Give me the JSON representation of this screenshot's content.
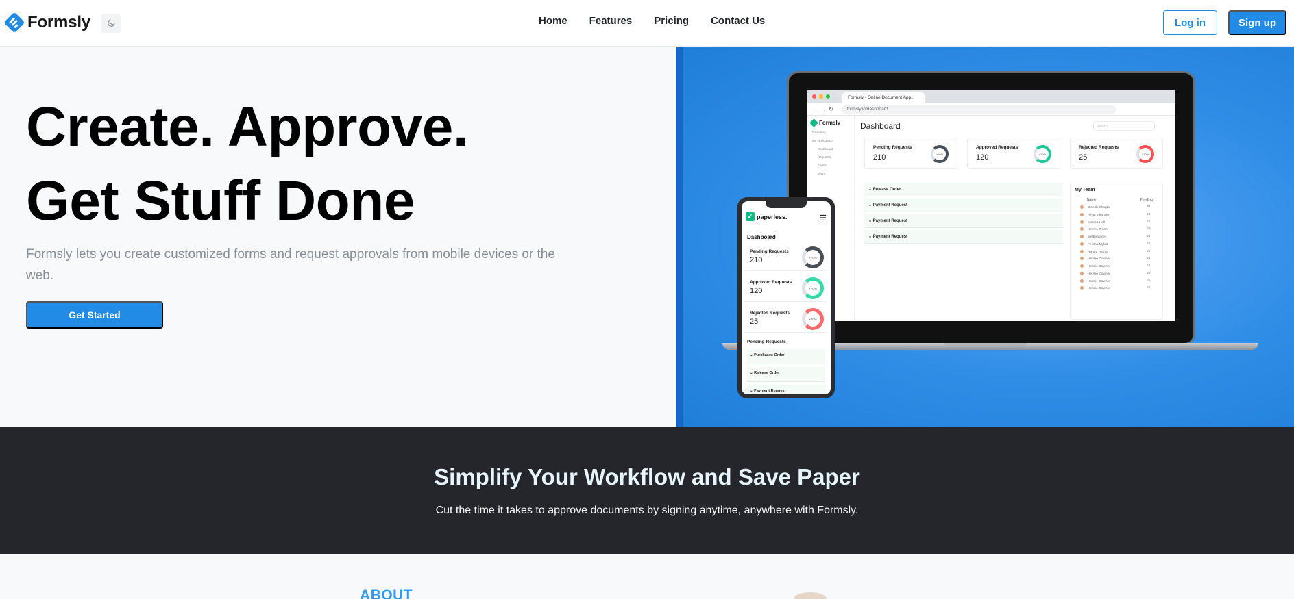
{
  "navbar": {
    "brand": "Formsly",
    "links": [
      "Home",
      "Features",
      "Pricing",
      "Contact Us"
    ],
    "login_label": "Log in",
    "signup_label": "Sign up",
    "theme_icon": "moon-icon"
  },
  "hero": {
    "title_line1": "Create. Approve.",
    "title_line2": "Get Stuff Done",
    "description": "Formsly lets you create customized forms and request approvals from mobile devices or the web.",
    "cta_label": "Get Started"
  },
  "laptop_mockup": {
    "tab_title": "Formsly - Online Document App...",
    "url": "formsly.io/dashboard",
    "sidebar_brand": "Formsly",
    "sidebar_items": [
      "Paperless",
      "My Workspace",
      "Dashboard",
      "Requests",
      "Forms",
      "Team"
    ],
    "page_title": "Dashboard",
    "search_placeholder": "Search",
    "stats": [
      {
        "label": "Pending Requests",
        "value": "210",
        "pct": "+10%",
        "color": "#495057"
      },
      {
        "label": "Approved Requests",
        "value": "120",
        "pct": "+10%",
        "color": "#20c997"
      },
      {
        "label": "Rejected Requests",
        "value": "25",
        "pct": "+10%",
        "color": "#fa5252"
      }
    ],
    "requests": [
      "Release Order",
      "Payment Request",
      "Payment Request",
      "Payment Request"
    ],
    "team": {
      "title": "My Team",
      "col_name": "Name",
      "col_pending": "Pending",
      "rows": [
        {
          "name": "Dinesh Chugtai",
          "pending": "20"
        },
        {
          "name": "Alicia Vikander",
          "pending": "10"
        },
        {
          "name": "Monica Hall",
          "pending": "15"
        },
        {
          "name": "Keeles Tyson",
          "pending": "15"
        },
        {
          "name": "Melba Lacey",
          "pending": "15"
        },
        {
          "name": "Felisha Myles",
          "pending": "15"
        },
        {
          "name": "Randy Young",
          "pending": "15"
        },
        {
          "name": "Hepsie Downer",
          "pending": "15"
        },
        {
          "name": "Hepsie Downer",
          "pending": "15"
        },
        {
          "name": "Hepsie Downer",
          "pending": "15"
        },
        {
          "name": "Hepsie Downer",
          "pending": "15"
        },
        {
          "name": "Hepsie Downer",
          "pending": "15"
        }
      ]
    }
  },
  "phone_mockup": {
    "brand": "paperless.",
    "page_title": "Dashboard",
    "stats": [
      {
        "label": "Pending Requests",
        "value": "210",
        "pct": "+70%",
        "color": "#495057"
      },
      {
        "label": "Approved Requests",
        "value": "120",
        "pct": "+70%",
        "color": "#38d9a9"
      },
      {
        "label": "Rejected Requests",
        "value": "25",
        "pct": "+70%",
        "color": "#ff6b6b"
      }
    ],
    "pending_title": "Pending Requests",
    "requests": [
      "Purchases Order",
      "Release Order",
      "Payment Request"
    ]
  },
  "band": {
    "title": "Simplify Your Workflow and Save Paper",
    "subtitle": "Cut the time it takes to approve documents by signing anytime, anywhere with Formsly."
  },
  "about": {
    "label": "ABOUT"
  },
  "colors": {
    "primary": "#228be6",
    "dark_band": "#25262b",
    "hero_bg": "#f8f9fa"
  }
}
